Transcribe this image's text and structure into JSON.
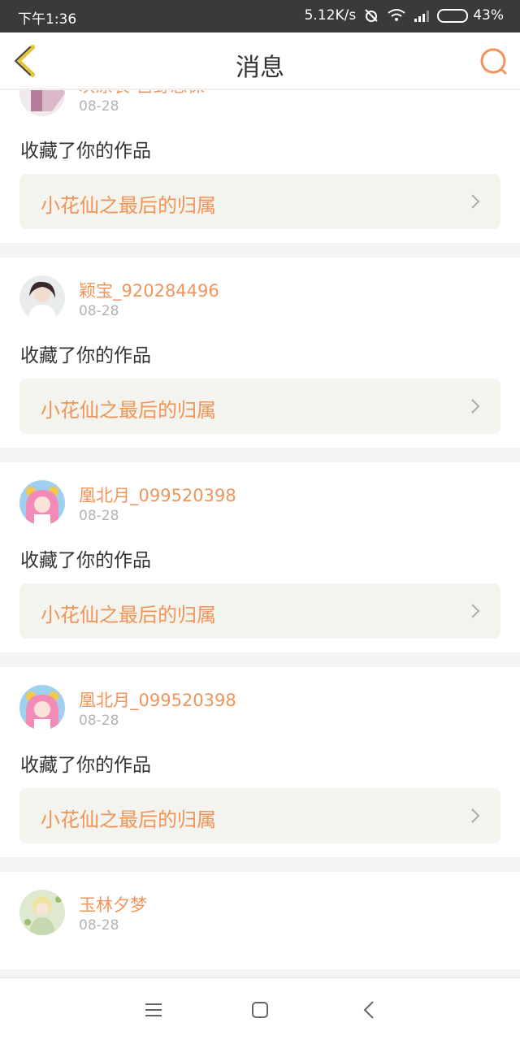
{
  "status_bar": {
    "time": "下午1:36",
    "speed": "5.12K/s",
    "battery": "43%",
    "battery_level": 0.43
  },
  "header": {
    "title": "消息",
    "back_icon": "back-chevron-icon",
    "search_icon": "search-icon"
  },
  "accent_color": "#f0945a",
  "messages": [
    {
      "name": "灰原哀-宫野志保",
      "date": "08-28",
      "action": "收藏了你的作品",
      "work": "小花仙之最后的归属"
    },
    {
      "name": "颖宝_920284496",
      "date": "08-28",
      "action": "收藏了你的作品",
      "work": "小花仙之最后的归属"
    },
    {
      "name": "凰北月_099520398",
      "date": "08-28",
      "action": "收藏了你的作品",
      "work": "小花仙之最后的归属"
    },
    {
      "name": "凰北月_099520398",
      "date": "08-28",
      "action": "收藏了你的作品",
      "work": "小花仙之最后的归属"
    },
    {
      "name": "玉林夕梦",
      "date": "08-28"
    }
  ]
}
